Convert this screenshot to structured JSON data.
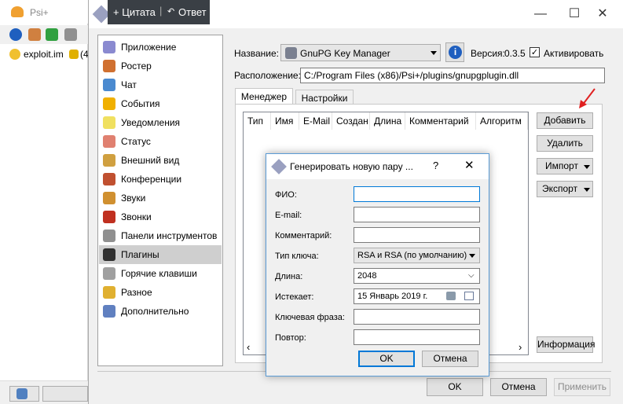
{
  "background_window": {
    "title": "Psi+",
    "contact": "exploit.im",
    "contact_suffix": "(4"
  },
  "quote_bar": {
    "quote_label": "+ Цитата",
    "reply_label": "Ответ"
  },
  "window_controls": {
    "minimize": "—",
    "maximize": "☐",
    "close": "✕"
  },
  "nav": {
    "items": [
      {
        "label": "Приложение",
        "icon": "wrench-icon",
        "color": "#8a8ad0"
      },
      {
        "label": "Ростер",
        "icon": "roster-icon",
        "color": "#d07030"
      },
      {
        "label": "Чат",
        "icon": "chat-icon",
        "color": "#4a8ad0"
      },
      {
        "label": "События",
        "icon": "warning-icon",
        "color": "#f0b000"
      },
      {
        "label": "Уведомления",
        "icon": "bulb-icon",
        "color": "#f0e060"
      },
      {
        "label": "Статус",
        "icon": "home-icon",
        "color": "#e08070"
      },
      {
        "label": "Внешний вид",
        "icon": "palette-icon",
        "color": "#d0a040"
      },
      {
        "label": "Конференции",
        "icon": "group-icon",
        "color": "#c05030"
      },
      {
        "label": "Звуки",
        "icon": "bell-icon",
        "color": "#d09030"
      },
      {
        "label": "Звонки",
        "icon": "phone-icon",
        "color": "#c03020"
      },
      {
        "label": "Панели инструментов",
        "icon": "toolbar-icon",
        "color": "#909090"
      },
      {
        "label": "Плагины",
        "icon": "plugin-icon",
        "color": "#303030"
      },
      {
        "label": "Горячие клавиши",
        "icon": "keyboard-icon",
        "color": "#a0a0a0"
      },
      {
        "label": "Разное",
        "icon": "shield-icon",
        "color": "#e0b030"
      },
      {
        "label": "Дополнительно",
        "icon": "gears-icon",
        "color": "#6080c0"
      }
    ]
  },
  "plugin": {
    "name_label": "Название:",
    "name_value": "GnuPG Key Manager",
    "version_label": "Версия:",
    "version_value": "0.3.5",
    "activate_label": "Активировать",
    "location_label": "Расположение:",
    "location_value": "C:/Program Files (x86)/Psi+/plugins/gnupgplugin.dll"
  },
  "tabs": [
    "Менеджер",
    "Настройки"
  ],
  "table": {
    "columns": [
      "Тип",
      "Имя",
      "E-Mail",
      "Создан",
      "Длина",
      "Комментарий",
      "Алгоритм"
    ]
  },
  "side_buttons": {
    "add": "Добавить",
    "delete": "Удалить",
    "import": "Импорт",
    "export": "Экспорт",
    "info": "Информация"
  },
  "footer": {
    "ok": "OK",
    "cancel": "Отмена",
    "apply": "Применить"
  },
  "dialog": {
    "title": "Генерировать новую пару ...",
    "help": "?",
    "close": "✕",
    "fields": {
      "fio_label": "ФИО:",
      "email_label": "E-mail:",
      "comment_label": "Комментарий:",
      "key_type_label": "Тип ключа:",
      "key_type_value": "RSA и RSA (по умолчанию)",
      "length_label": "Длина:",
      "length_value": "2048",
      "expires_label": "Истекает:",
      "expires_value": "15 Январь 2019 г.",
      "passphrase_label": "Ключевая фраза:",
      "repeat_label": "Повтор:"
    },
    "ok": "OK",
    "cancel": "Отмена"
  }
}
